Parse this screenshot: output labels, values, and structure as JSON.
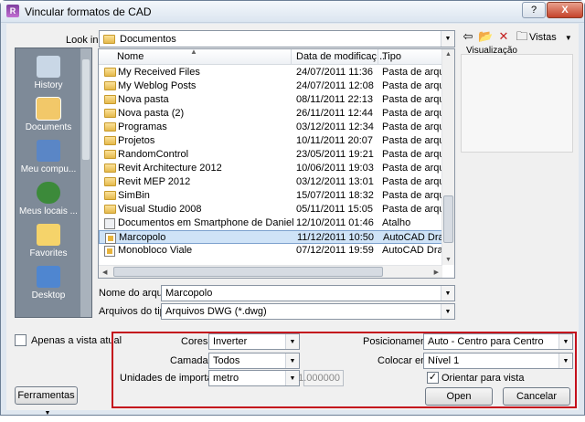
{
  "window": {
    "title": "Vincular formatos de CAD",
    "help_label": "?",
    "close_label": "X"
  },
  "lookin": {
    "label": "Look in:",
    "value": "Documentos"
  },
  "toolbar": {
    "views_label": "Vistas"
  },
  "preview": {
    "label": "Visualização"
  },
  "places": [
    {
      "label": "History",
      "icon": "history-icon",
      "color": "#c9d7e6"
    },
    {
      "label": "Documents",
      "icon": "documents-icon",
      "color": "#f2c869"
    },
    {
      "label": "Meu compu...",
      "icon": "computer-icon",
      "color": "#5a86c6"
    },
    {
      "label": "Meus locais ...",
      "icon": "network-icon",
      "color": "#3c8a3a"
    },
    {
      "label": "Favorites",
      "icon": "favorites-icon",
      "color": "#f5d36a"
    },
    {
      "label": "Desktop",
      "icon": "desktop-icon",
      "color": "#4f86d0"
    }
  ],
  "filelist": {
    "columns": [
      "Nome",
      "Data de modificaç...",
      "Tipo"
    ],
    "rows": [
      {
        "name": "My Received Files",
        "date": "24/07/2011 11:36",
        "type": "Pasta de arquivo",
        "kind": "folder"
      },
      {
        "name": "My Weblog Posts",
        "date": "24/07/2011 12:08",
        "type": "Pasta de arquivo",
        "kind": "folder"
      },
      {
        "name": "Nova pasta",
        "date": "08/11/2011 22:13",
        "type": "Pasta de arquivo",
        "kind": "folder"
      },
      {
        "name": "Nova pasta (2)",
        "date": "26/11/2011 12:44",
        "type": "Pasta de arquivo",
        "kind": "folder"
      },
      {
        "name": "Programas",
        "date": "03/12/2011 12:34",
        "type": "Pasta de arquivo",
        "kind": "folder"
      },
      {
        "name": "Projetos",
        "date": "10/11/2011 20:07",
        "type": "Pasta de arquivo",
        "kind": "folder"
      },
      {
        "name": "RandomControl",
        "date": "23/05/2011 19:21",
        "type": "Pasta de arquivo",
        "kind": "folder"
      },
      {
        "name": "Revit Architecture 2012",
        "date": "10/06/2011 19:03",
        "type": "Pasta de arquivo",
        "kind": "folder"
      },
      {
        "name": "Revit MEP 2012",
        "date": "03/12/2011 13:01",
        "type": "Pasta de arquivo",
        "kind": "folder"
      },
      {
        "name": "SimBin",
        "date": "15/07/2011 18:32",
        "type": "Pasta de arquivo",
        "kind": "folder"
      },
      {
        "name": "Visual Studio 2008",
        "date": "05/11/2011 15:05",
        "type": "Pasta de arquivo",
        "kind": "folder"
      },
      {
        "name": "Documentos em Smartphone de Daniel Oliv...",
        "date": "12/10/2011 01:46",
        "type": "Atalho",
        "kind": "shortcut"
      },
      {
        "name": "Marcopolo",
        "date": "11/12/2011 10:50",
        "type": "AutoCAD Drawing",
        "kind": "dwg"
      },
      {
        "name": "Monobloco Viale",
        "date": "07/12/2011 19:59",
        "type": "AutoCAD Drawing",
        "kind": "dwg"
      }
    ],
    "selected_index": 12
  },
  "filename": {
    "label": "Nome do arquivo:",
    "value": "Marcopolo"
  },
  "filetype": {
    "label": "Arquivos do tipo:",
    "value": "Arquivos DWG (*.dwg)"
  },
  "only_current_view": {
    "label": "Apenas a vista atual",
    "checked": false
  },
  "options": {
    "colors": {
      "label": "Cores:",
      "value": "Inverter"
    },
    "layers": {
      "label": "Camadas:",
      "value": "Todos"
    },
    "units": {
      "label": "Unidades de importação:",
      "value": "metro",
      "scale": "1.000000"
    },
    "positioning": {
      "label": "Posicionamento:",
      "value": "Auto - Centro para Centro"
    },
    "place_at": {
      "label": "Colocar em:",
      "value": "Nível 1"
    },
    "orient_to_view": {
      "label": "Orientar para vista",
      "checked": true
    }
  },
  "buttons": {
    "tools": "Ferramentas",
    "open": "Open",
    "cancel": "Cancelar"
  },
  "colors": {
    "highlight_box": "#c4101c",
    "selection": "#cfe3f7"
  }
}
